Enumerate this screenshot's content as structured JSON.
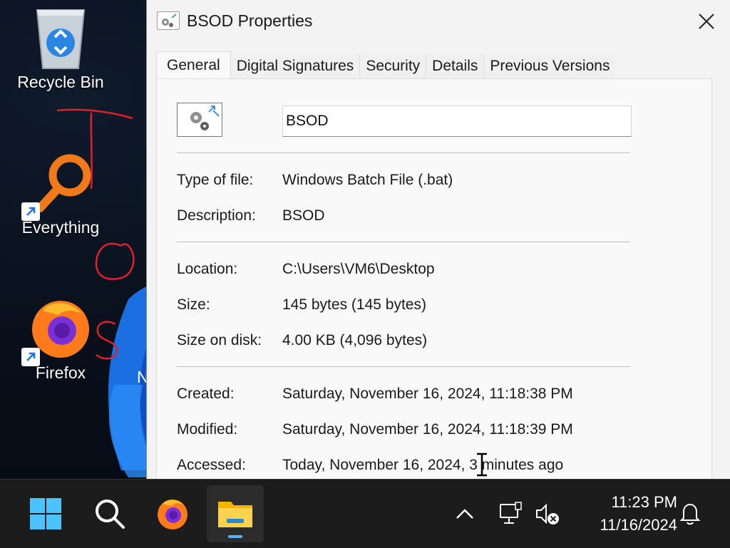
{
  "desktop": {
    "icons": [
      {
        "label": "Recycle Bin"
      },
      {
        "label": "Everything"
      },
      {
        "label": "Firefox"
      }
    ],
    "partial_icon_text": "N"
  },
  "dialog": {
    "title": "BSOD Properties",
    "tabs": [
      "General",
      "Digital Signatures",
      "Security",
      "Details",
      "Previous Versions"
    ],
    "active_tab": "General",
    "file_name": "BSOD",
    "properties": {
      "type": {
        "label": "Type of file:",
        "value": "Windows Batch File (.bat)"
      },
      "description": {
        "label": "Description:",
        "value": "BSOD"
      },
      "location": {
        "label": "Location:",
        "value": "C:\\Users\\VM6\\Desktop"
      },
      "size": {
        "label": "Size:",
        "value": "145 bytes (145 bytes)"
      },
      "size_on_disk": {
        "label": "Size on disk:",
        "value": "4.00 KB (4,096 bytes)"
      },
      "created": {
        "label": "Created:",
        "value": "Saturday, November 16, 2024, 11:18:38 PM"
      },
      "modified": {
        "label": "Modified:",
        "value": "Saturday, November 16, 2024, 11:18:39 PM"
      },
      "accessed": {
        "label": "Accessed:",
        "value": "Today, November 16, 2024, 3 minutes ago"
      }
    }
  },
  "taskbar": {
    "pinned": [
      "start-icon",
      "search-icon",
      "firefox-icon",
      "file-explorer-icon"
    ],
    "active_app": "file-explorer-icon",
    "tray": [
      "chevron-up-icon",
      "network-icon",
      "volume-muted-icon",
      "notification-bell-icon"
    ],
    "time": "11:23 PM",
    "date": "11/16/2024"
  },
  "colors": {
    "accent": "#5cb3f5",
    "annotation": "#e0202a",
    "dialog_bg": "#f3f3f3"
  }
}
